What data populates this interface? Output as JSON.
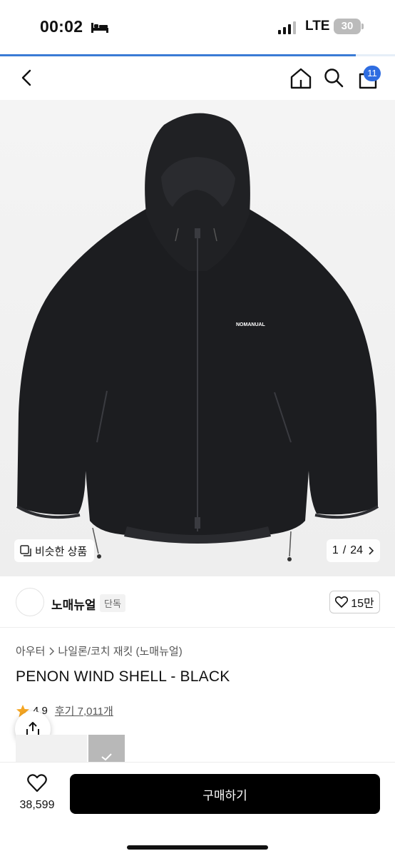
{
  "status_bar": {
    "time": "00:02",
    "network": "LTE",
    "battery": "30"
  },
  "page_progress": 0.9,
  "header": {
    "cart_count": "11"
  },
  "image": {
    "logo_text": "NOMANUAL",
    "similar_label": "비슷한 상품",
    "page_current": "1",
    "page_sep": "/",
    "page_total": "24"
  },
  "brand": {
    "name": "노매뉴얼",
    "tag": "단독",
    "likes": "15만"
  },
  "breadcrumb": [
    "아우터",
    "나일론/코치 재킷 (노매뉴얼)"
  ],
  "product": {
    "title": "PENON WIND SHELL - BLACK"
  },
  "rating": {
    "score": "4.9",
    "reviews": "후기 7,011개"
  },
  "bottom": {
    "wish_count": "38,599",
    "buy_label": "구매하기"
  },
  "colors": {
    "accent": "#2f6de1",
    "buy_button": "#000000",
    "star": "#f5a623"
  }
}
